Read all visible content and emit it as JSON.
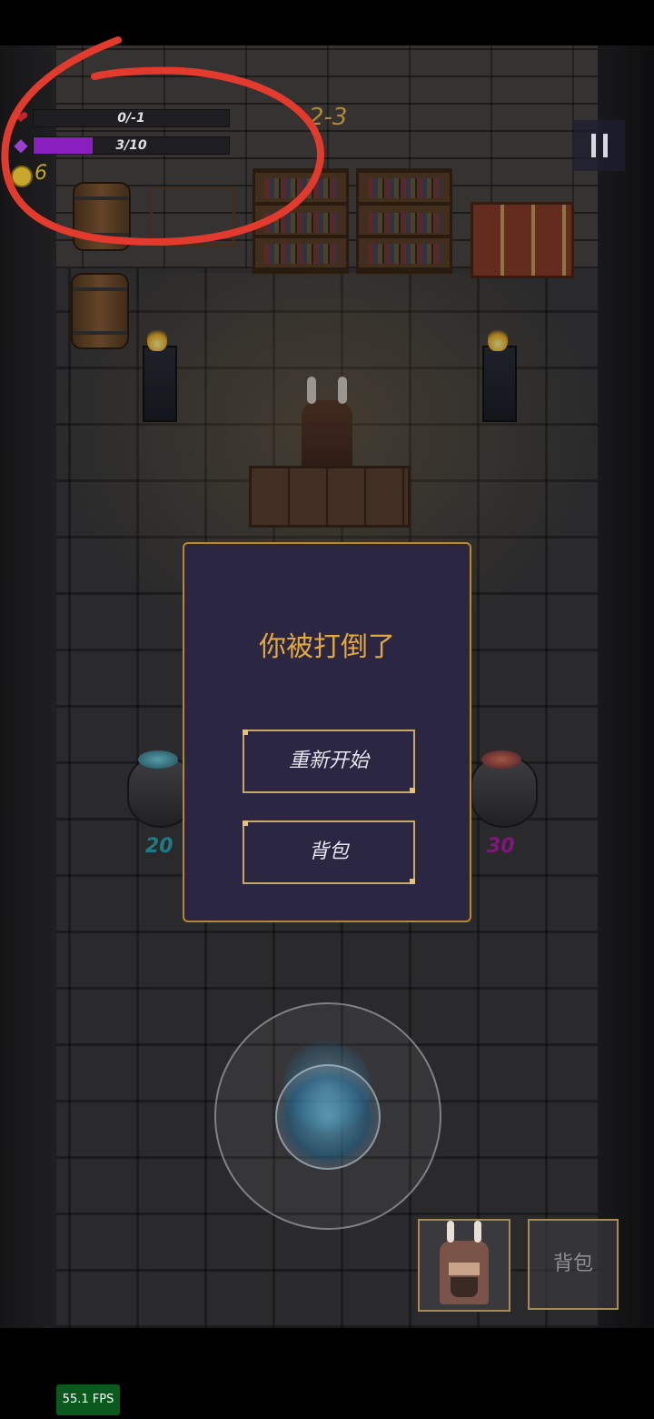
{
  "hud": {
    "health_text": "0/-1",
    "health_fraction": 0,
    "mana_text": "3/10",
    "mana_fraction": 0.3,
    "gold_text": "6",
    "level_text": "2-3",
    "heart_icon": "heart-icon",
    "mana_icon": "diamond-icon",
    "coin_icon": "coin-icon"
  },
  "shop": {
    "left_price": "20",
    "right_price": "30"
  },
  "dialog": {
    "title": "你被打倒了",
    "restart_label": "重新开始",
    "bag_label": "背包"
  },
  "bottom": {
    "bag_label": "背包"
  },
  "fps": "55.1 FPS",
  "colors": {
    "dialog_bg": "#2b2641",
    "dialog_border": "#b8863a",
    "title_gold": "#e3a83e",
    "mana_purple": "#8a1fc0",
    "heart_red": "#c0262e",
    "price_cyan": "#2aa9b8",
    "price_magenta": "#b020b0",
    "annotation_red": "#e23a2c"
  }
}
